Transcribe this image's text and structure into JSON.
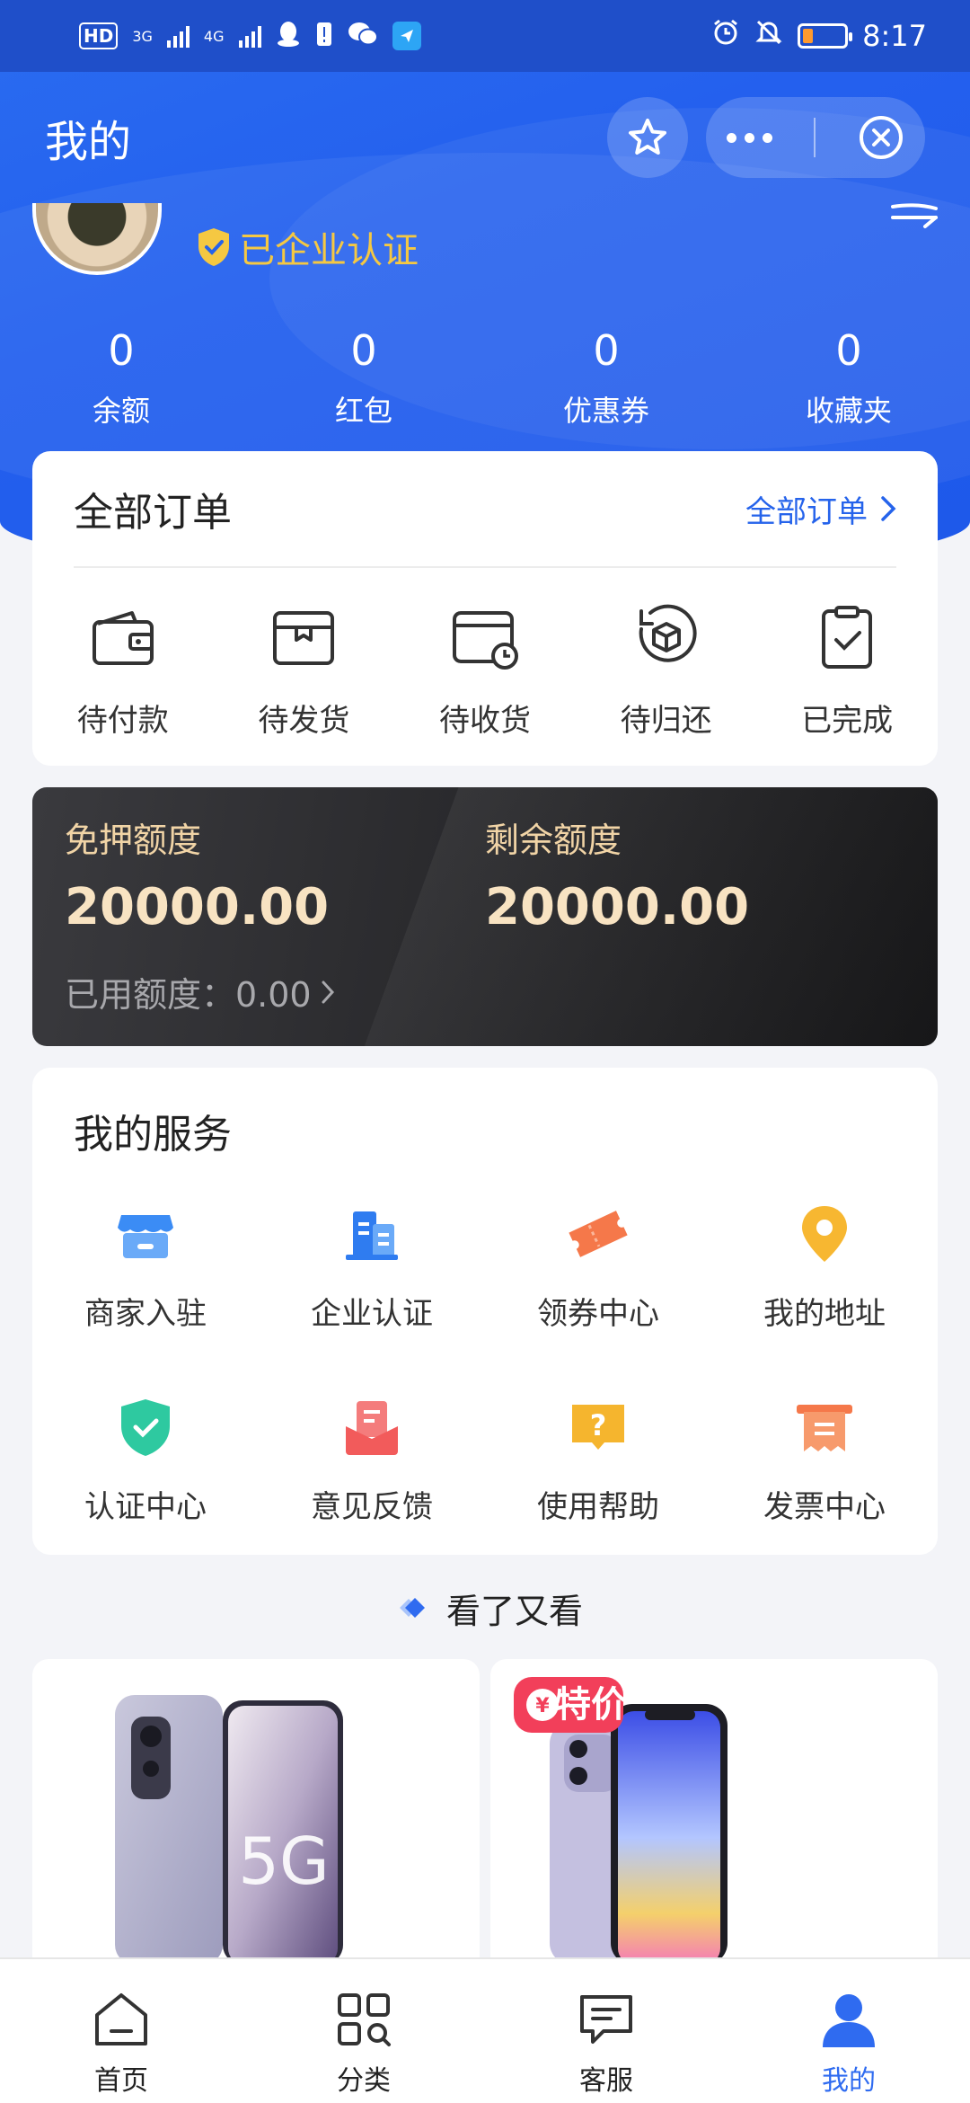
{
  "status_bar": {
    "network_chip": "HD",
    "net1": "3G",
    "net2": "4G",
    "time": "8:17",
    "battery_level": 0.25,
    "battery_color": "#ff9a2e"
  },
  "header": {
    "title": "我的",
    "favorite_icon": "star-icon",
    "more_icon": "more-icon",
    "close_icon": "close-circle-icon"
  },
  "profile": {
    "cert_text": "已企业认证",
    "cert_color": "#f5c842"
  },
  "stats": [
    {
      "value": "0",
      "label": "余额"
    },
    {
      "value": "0",
      "label": "红包"
    },
    {
      "value": "0",
      "label": "优惠券"
    },
    {
      "value": "0",
      "label": "收藏夹"
    }
  ],
  "orders": {
    "title": "全部订单",
    "more_label": "全部订单",
    "items": [
      {
        "label": "待付款",
        "icon": "wallet-icon"
      },
      {
        "label": "待发货",
        "icon": "package-icon"
      },
      {
        "label": "待收货",
        "icon": "delivery-clock-icon"
      },
      {
        "label": "待归还",
        "icon": "return-box-icon"
      },
      {
        "label": "已完成",
        "icon": "clipboard-check-icon"
      }
    ]
  },
  "quota": {
    "deposit_free_label": "免押额度",
    "deposit_free_value": "20000.00",
    "remaining_label": "剩余额度",
    "remaining_value": "20000.00",
    "used_text": "已用额度：0.00"
  },
  "services": {
    "title": "我的服务",
    "items": [
      {
        "label": "商家入驻",
        "icon": "store-icon",
        "color": "#3b8cf5"
      },
      {
        "label": "企业认证",
        "icon": "building-icon",
        "color": "#2f7cf0"
      },
      {
        "label": "领券中心",
        "icon": "ticket-icon",
        "color": "#f5784a"
      },
      {
        "label": "我的地址",
        "icon": "location-pin-icon",
        "color": "#f7b731"
      },
      {
        "label": "认证中心",
        "icon": "shield-check-icon",
        "color": "#2ec9a0"
      },
      {
        "label": "意见反馈",
        "icon": "feedback-icon",
        "color": "#f25b5b"
      },
      {
        "label": "使用帮助",
        "icon": "help-icon",
        "color": "#f5b52e"
      },
      {
        "label": "发票中心",
        "icon": "invoice-icon",
        "color": "#f5784a"
      }
    ]
  },
  "recommend": {
    "title": "看了又看",
    "products": [
      {
        "badge": "5G"
      },
      {
        "badge": "特价"
      }
    ]
  },
  "tabbar": [
    {
      "label": "首页",
      "icon": "home-icon",
      "active": false
    },
    {
      "label": "分类",
      "icon": "category-icon",
      "active": false
    },
    {
      "label": "客服",
      "icon": "customer-service-icon",
      "active": false
    },
    {
      "label": "我的",
      "icon": "user-icon",
      "active": true
    }
  ],
  "colors": {
    "brand_blue": "#2563eb",
    "active_tab": "#2f6bf0",
    "quota_gold": "#f1d4a6"
  }
}
